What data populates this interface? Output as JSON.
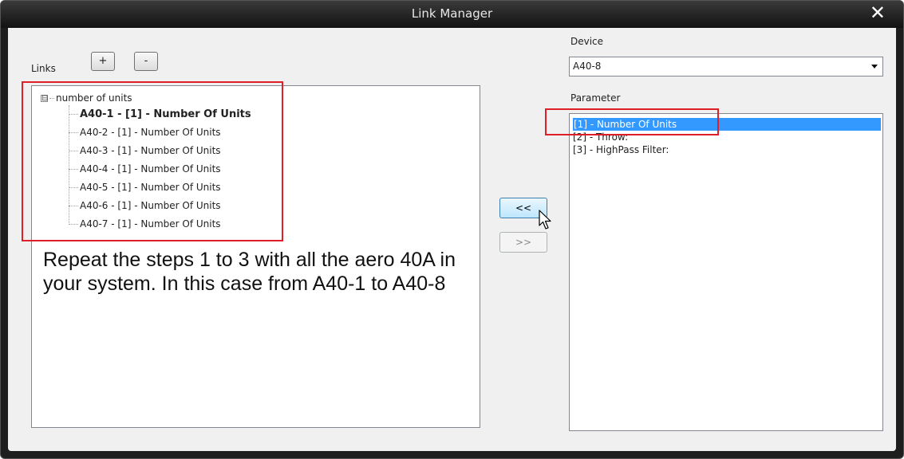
{
  "window": {
    "title": "Link Manager",
    "close_glyph": "✕"
  },
  "links": {
    "label": "Links",
    "add_label": "+",
    "remove_label": "-",
    "tree": {
      "expander_glyph": "⊟",
      "root_label": "number of units",
      "items": [
        {
          "label": "A40-1 - [1] - Number Of Units",
          "bold": true
        },
        {
          "label": "A40-2 - [1] - Number Of Units",
          "bold": false
        },
        {
          "label": "A40-3 - [1] - Number Of Units",
          "bold": false
        },
        {
          "label": "A40-4 - [1] - Number Of Units",
          "bold": false
        },
        {
          "label": "A40-5 - [1] - Number Of Units",
          "bold": false
        },
        {
          "label": "A40-6 - [1] - Number Of Units",
          "bold": false
        },
        {
          "label": "A40-7 - [1] - Number Of Units",
          "bold": false
        }
      ]
    }
  },
  "annotation": {
    "text": "Repeat the steps 1 to 3 with all the aero 40A in your system. In this case from A40-1 to A40-8",
    "highlight_color": "#e01e26"
  },
  "device": {
    "label": "Device",
    "selected": "A40-8"
  },
  "parameter": {
    "label": "Parameter",
    "items": [
      {
        "label": "[1] - Number Of Units",
        "selected": true
      },
      {
        "label": "[2] - Throw:",
        "selected": false
      },
      {
        "label": "[3] - HighPass Filter:",
        "selected": false
      }
    ]
  },
  "buttons": {
    "link_left_label": "<<",
    "link_right_label": ">>"
  },
  "colors": {
    "selection": "#3399ff",
    "titlebar": "#1e1e1e"
  }
}
